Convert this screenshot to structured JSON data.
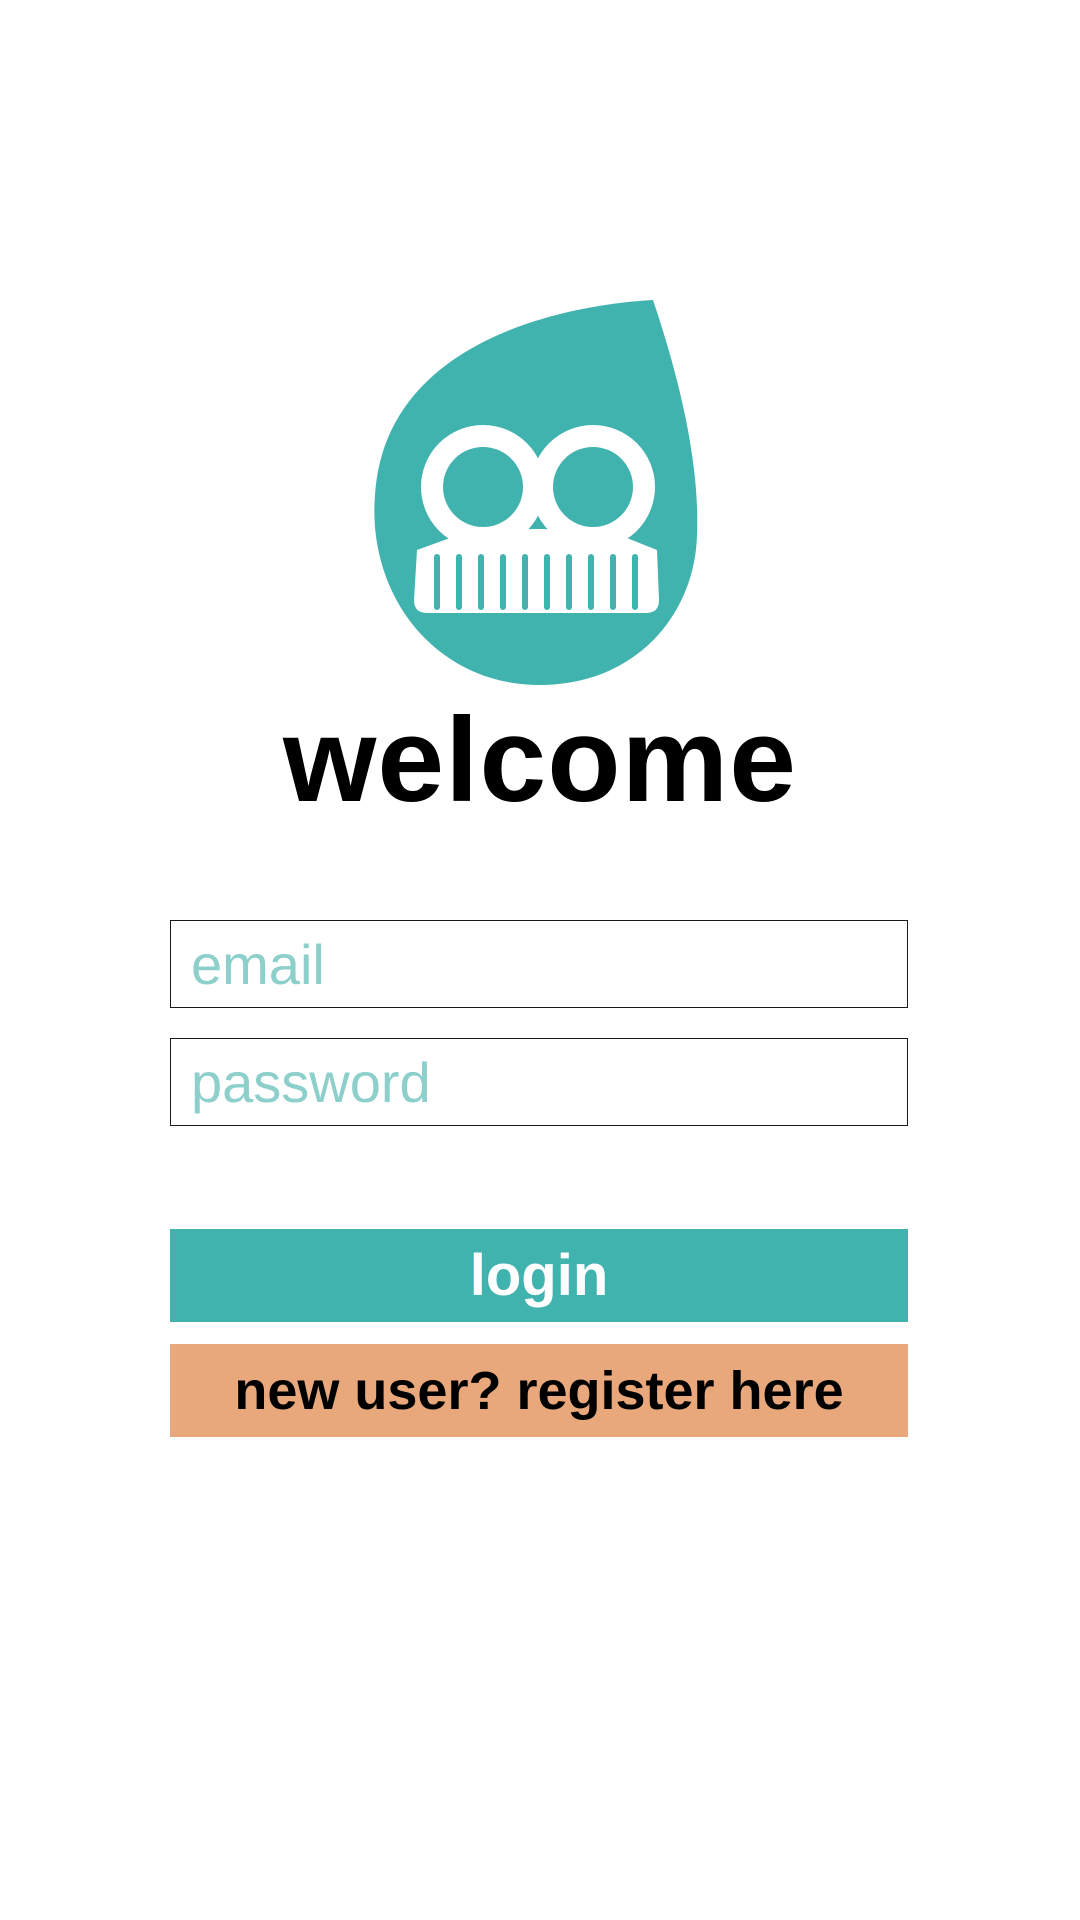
{
  "colors": {
    "brand_teal": "#41b3af",
    "accent_peach": "#e8a87c",
    "placeholder_teal": "#8ccfcb",
    "text_dark": "#000000",
    "background": "#ffffff"
  },
  "logo": {
    "icon": "leaf-comb-logo-icon"
  },
  "header": {
    "title": "welcome"
  },
  "form": {
    "email_placeholder": "email",
    "password_placeholder": "password",
    "login_label": "login",
    "register_label": "new user? register here"
  }
}
